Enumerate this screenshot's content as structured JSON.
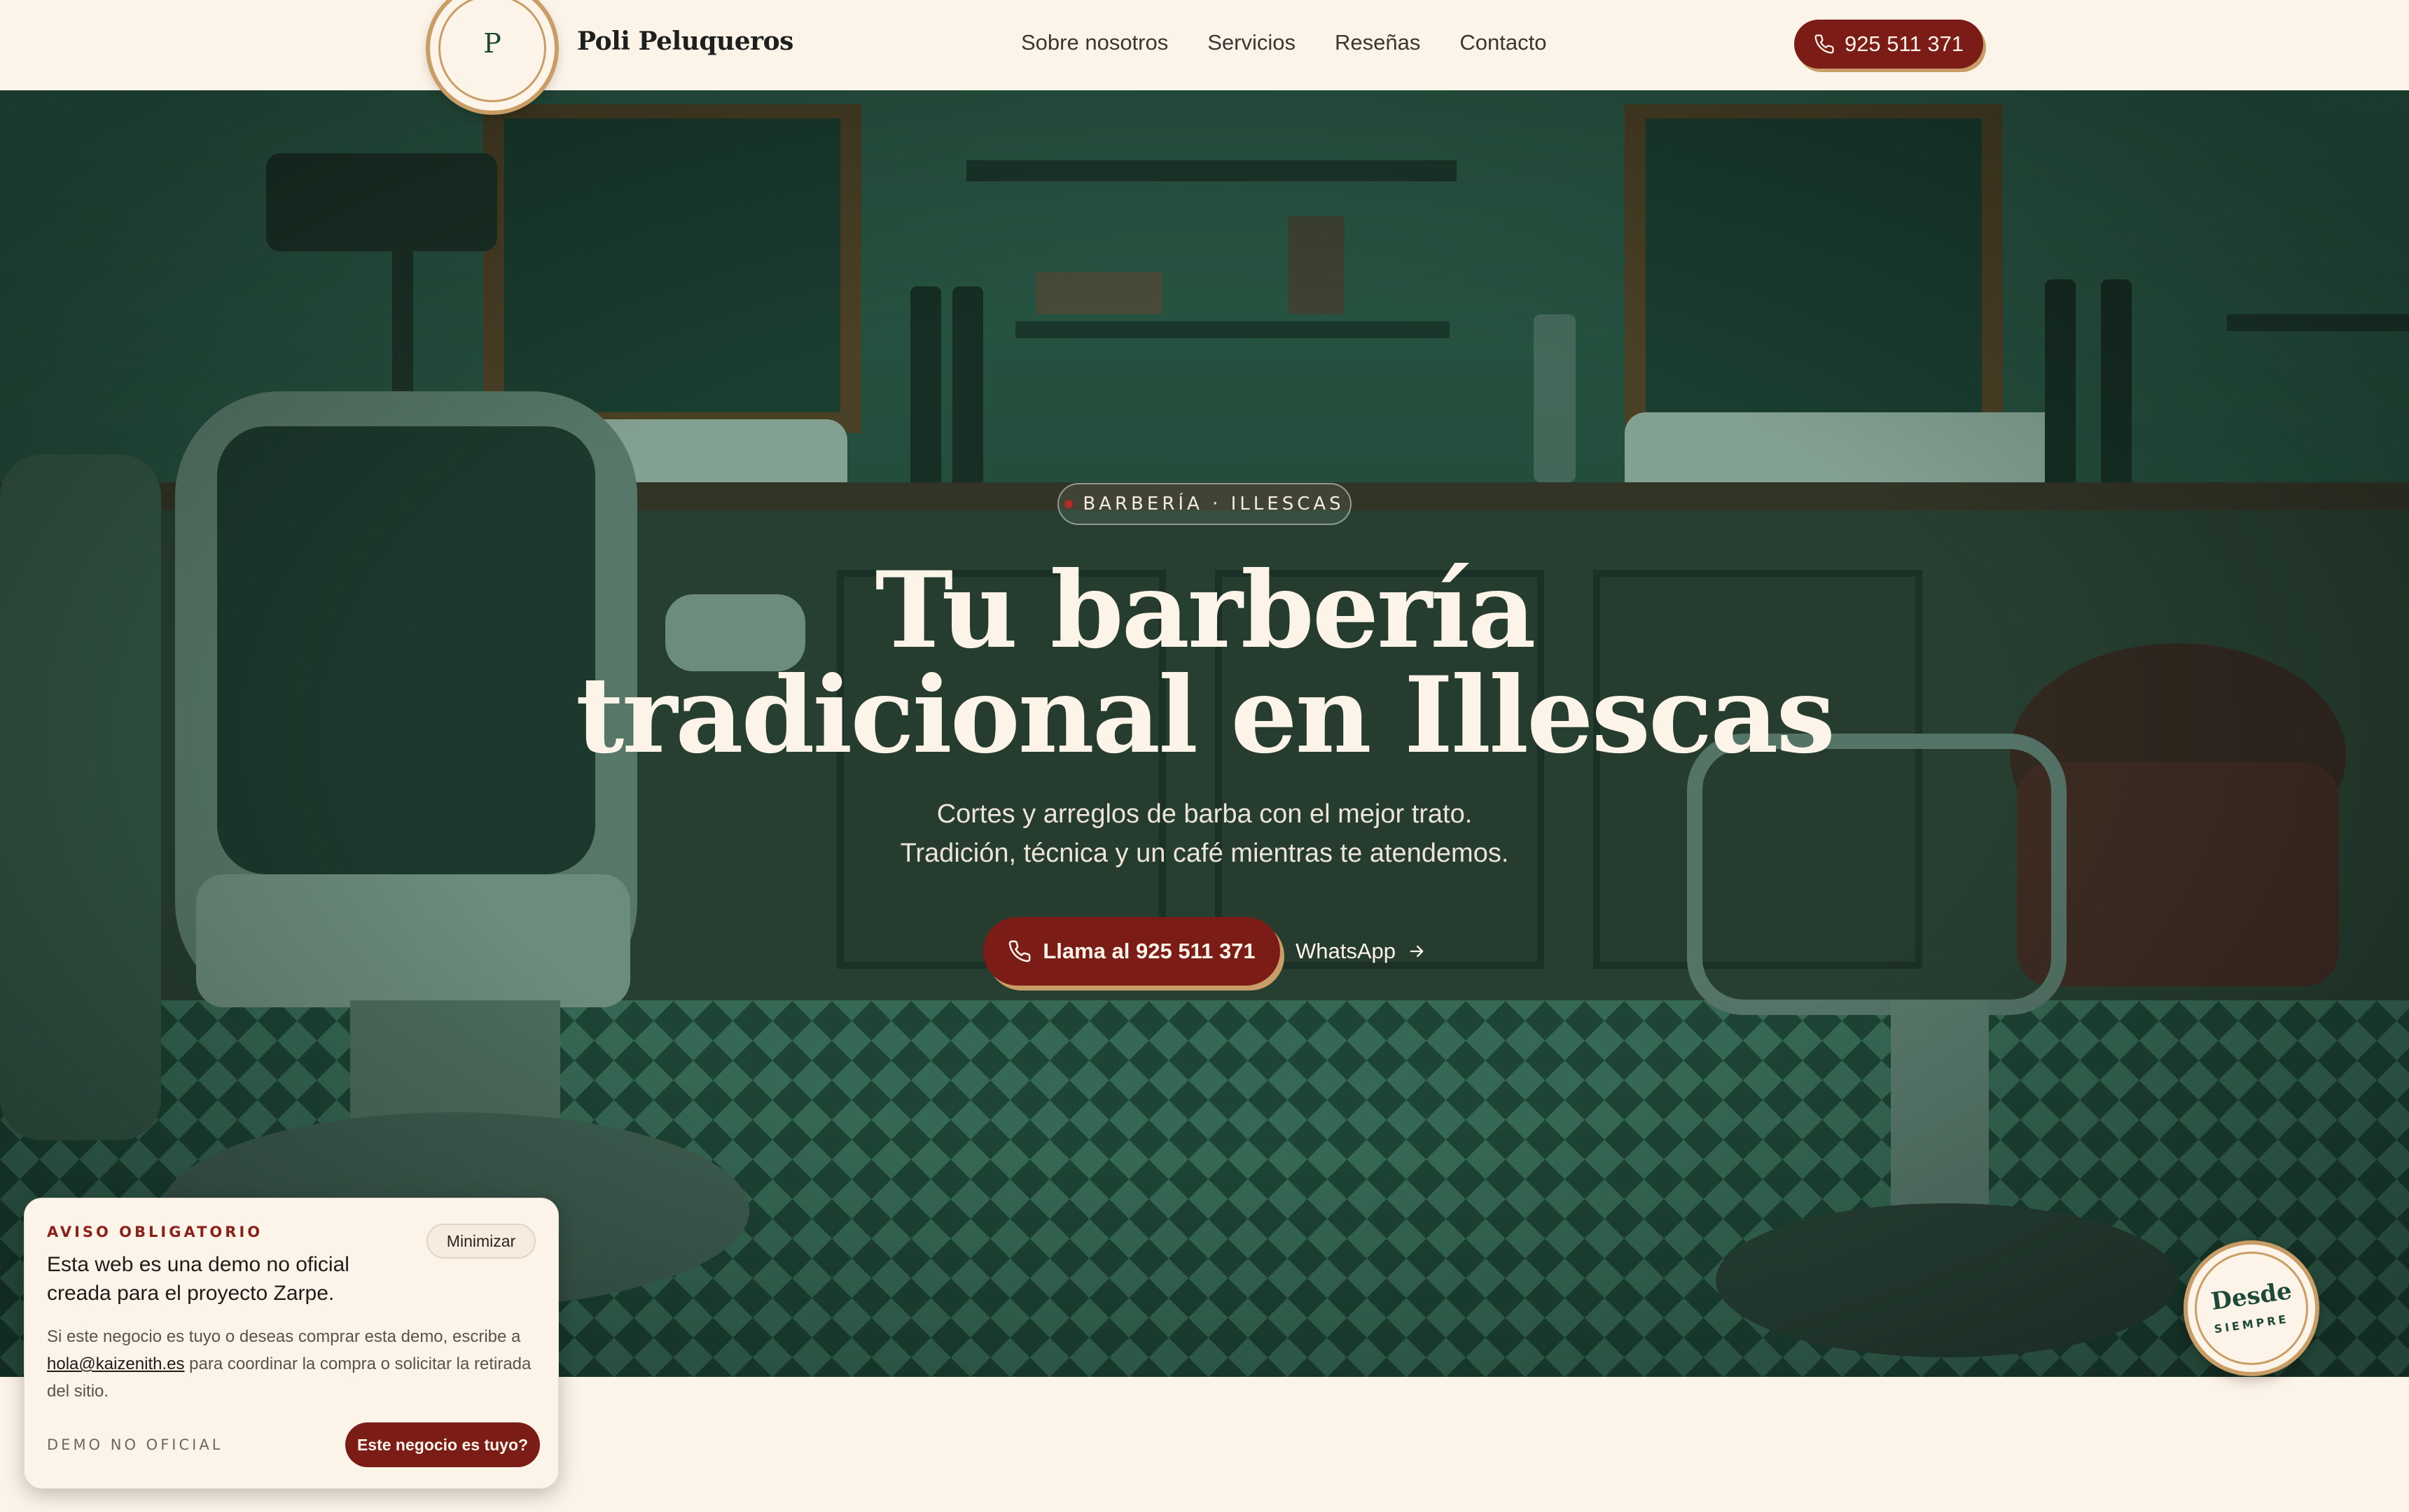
{
  "header": {
    "logo_letter": "P",
    "brand": "Poli Peluqueros",
    "nav": [
      "Sobre nosotros",
      "Servicios",
      "Reseñas",
      "Contacto"
    ],
    "phone": "925 511 371"
  },
  "hero": {
    "kicker": "BARBERÍA · ILLESCAS",
    "title_line1": "Tu barbería",
    "title_line2": "tradicional en Illescas",
    "subtitle_line1": "Cortes y arreglos de barba con el mejor trato.",
    "subtitle_line2": "Tradición, técnica y un café mientras te atendemos.",
    "cta_call": "Llama al 925 511 371",
    "cta_whatsapp": "WhatsApp"
  },
  "since_badge": {
    "word1": "Desde",
    "word2": "SIEMPRE"
  },
  "notice": {
    "kicker": "AVISO OBLIGATORIO",
    "minimize": "Minimizar",
    "title": "Esta web es una demo no oficial creada para el proyecto Zarpe.",
    "body_before": "Si este negocio es tuyo o deseas comprar esta demo, escribe a ",
    "email": "hola@kaizenith.es",
    "body_after": " para coordinar la compra o solicitar la retirada del sitio.",
    "demo_label": "DEMO NO OFICIAL",
    "cta": "Este negocio es tuyo?"
  },
  "colors": {
    "cream": "#fdf4e9",
    "burgundy": "#7c1c17",
    "gold": "#c99e66",
    "green": "#1d4a38"
  }
}
